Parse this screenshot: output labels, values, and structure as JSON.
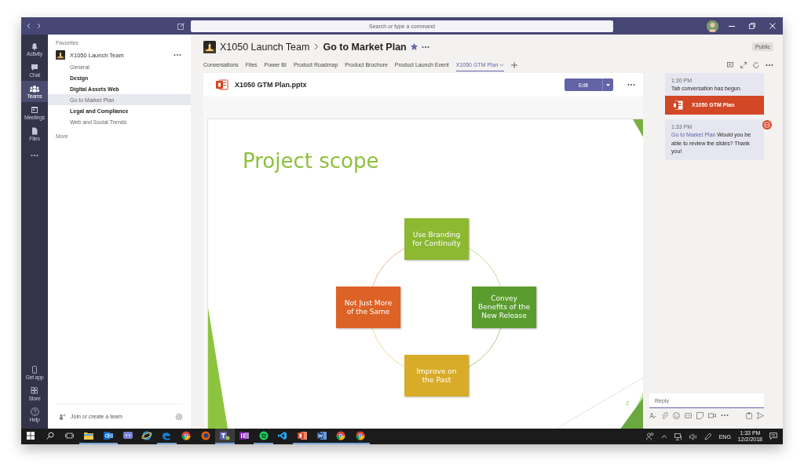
{
  "window": {
    "search": {
      "placeholder": "Search or type a command"
    }
  },
  "rail": {
    "items": [
      {
        "kind": "activity",
        "label": "Activity",
        "selected": false
      },
      {
        "kind": "chat",
        "label": "Chat",
        "selected": false
      },
      {
        "kind": "teams",
        "label": "Teams",
        "selected": true
      },
      {
        "kind": "meetings",
        "label": "Meetings",
        "selected": false
      },
      {
        "kind": "files",
        "label": "Files",
        "selected": false
      },
      {
        "kind": "more",
        "selected": false
      }
    ],
    "bottom_items": [
      {
        "kind": "get_app",
        "label": "Get app"
      },
      {
        "kind": "store",
        "label": "Store"
      },
      {
        "kind": "help",
        "label": "Help"
      }
    ]
  },
  "sidebar": {
    "heading": "Favorites",
    "team": {
      "name": "X1050 Launch Team",
      "channels": [
        {
          "name": "General",
          "unread": false,
          "selected": false
        },
        {
          "name": "Design",
          "unread": true,
          "selected": false
        },
        {
          "name": "Digital Assets Web",
          "unread": true,
          "selected": false
        },
        {
          "name": "Go to Market Plan",
          "unread": false,
          "selected": true
        },
        {
          "name": "Legal and Compliance",
          "unread": true,
          "selected": false
        },
        {
          "name": "Web and Social Trends",
          "unread": false,
          "selected": false
        }
      ]
    },
    "more": "More",
    "join": "Join or create a team"
  },
  "header": {
    "team": "X1050 Launch Team",
    "channel": "Go to Market Plan",
    "favorite": true,
    "visibility": "Public"
  },
  "tabs": [
    {
      "label": "Conversations",
      "selected": false
    },
    {
      "label": "Files",
      "selected": false
    },
    {
      "label": "Power BI",
      "selected": false
    },
    {
      "label": "Product Roadmap",
      "selected": false
    },
    {
      "label": "Product Brochure",
      "selected": false
    },
    {
      "label": "Product Launch Event",
      "selected": false
    },
    {
      "label": "X1050 GTM Plan",
      "selected": true
    }
  ],
  "document": {
    "file_name": "X1050 GTM Plan.pptx",
    "edit_button": "Edit",
    "slide": {
      "title": "Project scope",
      "boxes": [
        {
          "text": "Use Branding for Continuity",
          "color": "#8cb832"
        },
        {
          "text": "Convey Benefits of the New Release",
          "color": "#5a9c2e"
        },
        {
          "text": "Improve on the Past",
          "color": "#d8ab28"
        },
        {
          "text": "Not Just More of the Same",
          "color": "#dc6226"
        }
      ],
      "page_number": "2"
    }
  },
  "chat": {
    "messages": [
      {
        "time": "1:30 PM",
        "text": "Tab conversation has begun.",
        "attachment": "X1050 GTM Plan"
      },
      {
        "time": "1:33 PM",
        "mention": "Go to Market Plan",
        "text": "Would you be able to review the slides? Thank you!"
      }
    ],
    "reply": {
      "placeholder": "Reply"
    }
  },
  "taskbar": {
    "apps": [
      {
        "kind": "folder",
        "running": true,
        "selected": false
      },
      {
        "kind": "mail",
        "running": true,
        "selected": false
      },
      {
        "kind": "chat",
        "running": false,
        "selected": false
      },
      {
        "kind": "ie",
        "running": false,
        "selected": false
      },
      {
        "kind": "edge",
        "running": true,
        "selected": false
      },
      {
        "kind": "chrome",
        "running": false,
        "selected": false
      },
      {
        "kind": "firefox",
        "running": false,
        "selected": false
      },
      {
        "kind": "teams",
        "running": true,
        "selected": true
      },
      {
        "kind": "onenote",
        "running": false,
        "selected": false
      },
      {
        "kind": "music",
        "running": true,
        "selected": false
      },
      {
        "kind": "code",
        "running": false,
        "selected": false
      },
      {
        "kind": "powerpoint",
        "running": true,
        "selected": false
      },
      {
        "kind": "word",
        "running": true,
        "selected": false
      },
      {
        "kind": "chrome",
        "running": true,
        "selected": false
      },
      {
        "kind": "chrome",
        "running": true,
        "selected": false
      }
    ],
    "language": "ENG",
    "time": "1:33 PM",
    "date": "12/2/2018"
  }
}
